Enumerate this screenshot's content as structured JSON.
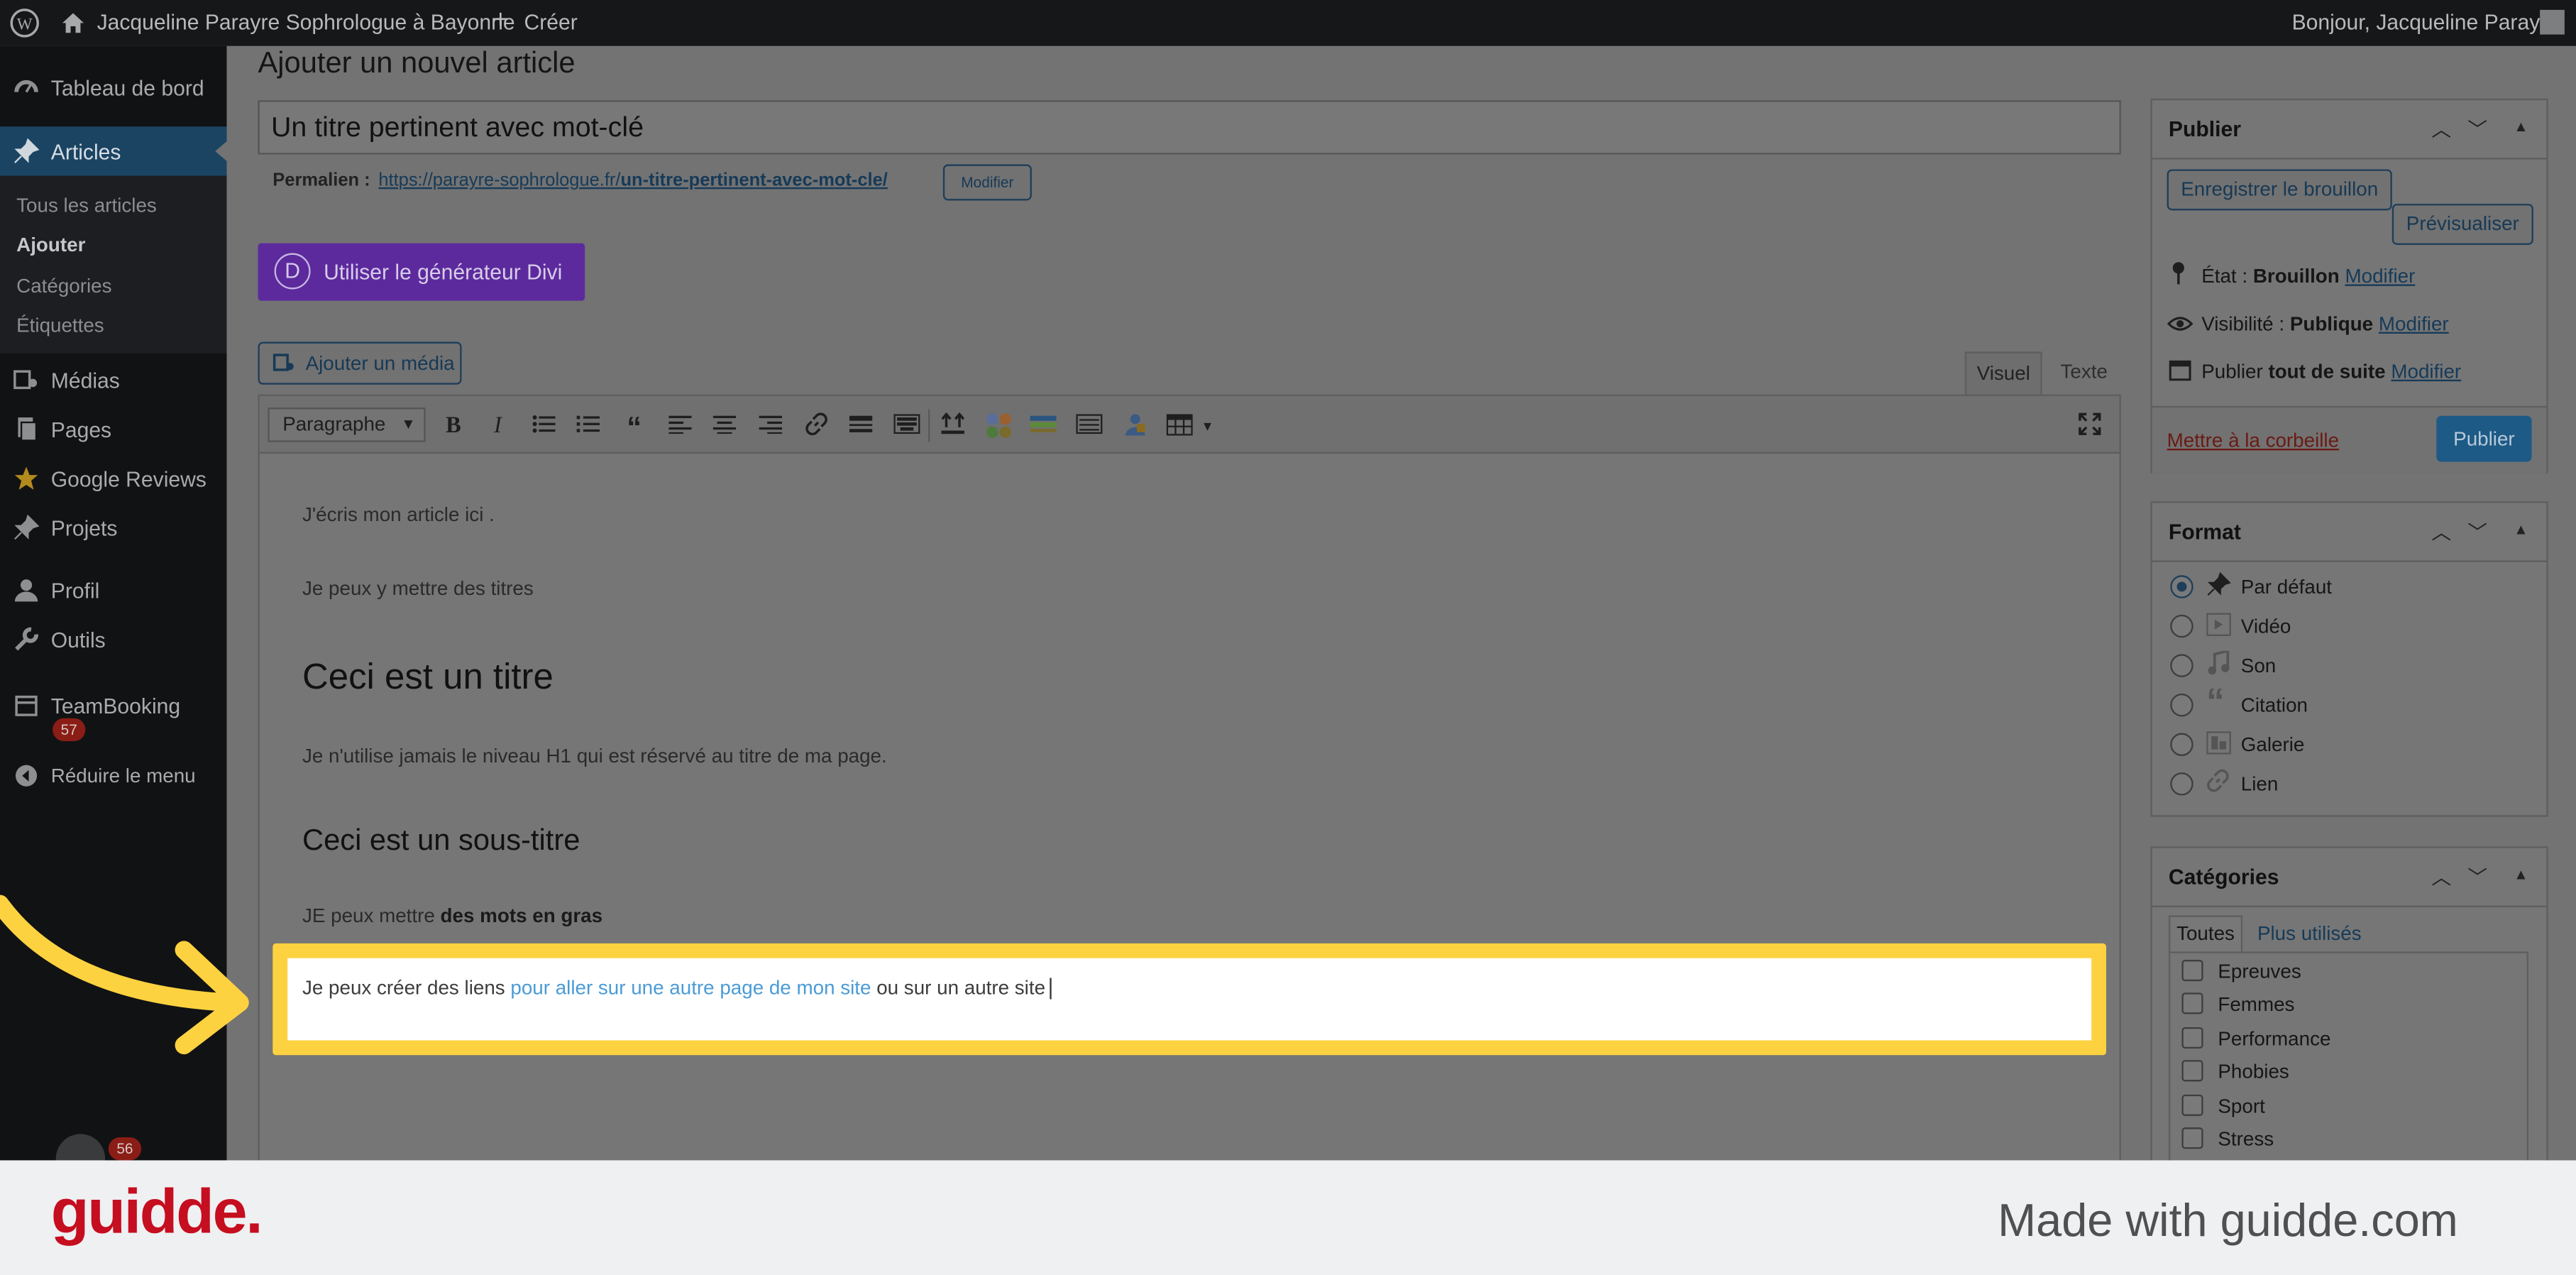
{
  "adminbar": {
    "site_name": "Jacqueline Parayre Sophrologue à Bayonne",
    "new_label": "Créer",
    "greeting": "Bonjour, Jacqueline Parayre"
  },
  "sidebar": {
    "items": [
      {
        "label": "Tableau de bord",
        "icon": "dashboard-icon"
      },
      {
        "label": "Articles",
        "icon": "pin-icon"
      },
      {
        "label": "Médias",
        "icon": "media-icon"
      },
      {
        "label": "Pages",
        "icon": "pages-icon"
      },
      {
        "label": "Google Reviews",
        "icon": "star-icon"
      },
      {
        "label": "Projets",
        "icon": "pin-icon"
      },
      {
        "label": "Profil",
        "icon": "user-icon"
      },
      {
        "label": "Outils",
        "icon": "wrench-icon"
      },
      {
        "label": "TeamBooking",
        "icon": "calendar-icon"
      }
    ],
    "submenu": [
      "Tous les articles",
      "Ajouter",
      "Catégories",
      "Étiquettes"
    ],
    "teambooking_badge": "57",
    "collapse_label": "Réduire le menu",
    "bottom_badge": "56"
  },
  "page": {
    "heading": "Ajouter un nouvel article",
    "title_value": "Un titre pertinent avec mot-clé"
  },
  "permalink": {
    "label": "Permalien :",
    "url_base": "https://parayre-sophrologue.fr/",
    "url_slug": "un-titre-pertinent-avec-mot-cle/",
    "edit_label": "Modifier"
  },
  "divi_button": {
    "label": "Utiliser le générateur Divi",
    "letter": "D"
  },
  "media_button": {
    "label": "Ajouter un média"
  },
  "editor_tabs": {
    "visual": "Visuel",
    "text": "Texte"
  },
  "toolbar": {
    "format_select": "Paragraphe",
    "bold": "B",
    "italic": "I"
  },
  "content": {
    "p1": "J'écris mon article ici .",
    "p2": "Je peux y mettre des titres",
    "h2": "Ceci est un titre",
    "p3": "Je n'utilise jamais le niveau H1 qui est réservé au titre de ma page.",
    "h3": "Ceci est un sous-titre",
    "p4_prefix": "JE peux mettre ",
    "p4_bold": "des mots en gras",
    "p5_prefix": "Je peux créer des liens ",
    "p5_link": "pour aller sur une autre page de mon site",
    "p5_suffix": " ou sur un autre site"
  },
  "publish_box": {
    "title": "Publier",
    "save_draft": "Enregistrer le brouillon",
    "preview": "Prévisualiser",
    "status_label": "État :",
    "status_value": "Brouillon",
    "visibility_label": "Visibilité :",
    "visibility_value": "Publique",
    "schedule_label": "Publier",
    "schedule_value": "tout de suite",
    "edit_label": "Modifier",
    "trash_label": "Mettre à la corbeille",
    "publish_button": "Publier"
  },
  "format_box": {
    "title": "Format",
    "options": [
      "Par défaut",
      "Vidéo",
      "Son",
      "Citation",
      "Galerie",
      "Lien"
    ],
    "selected": "Par défaut"
  },
  "categories_box": {
    "title": "Catégories",
    "tab_all": "Toutes",
    "tab_popular": "Plus utilisés",
    "items": [
      "Epreuves",
      "Femmes",
      "Performance",
      "Phobies",
      "Sport",
      "Stress"
    ]
  },
  "footer": {
    "logo": "guidde.",
    "tagline": "Made with guidde.com"
  },
  "colors": {
    "highlight": "#fdd240",
    "divi_purple": "#5c2a9d",
    "link_blue": "#4a9bd6",
    "footer_red": "#c50e1f",
    "admin_blue": "#1d5a86"
  }
}
